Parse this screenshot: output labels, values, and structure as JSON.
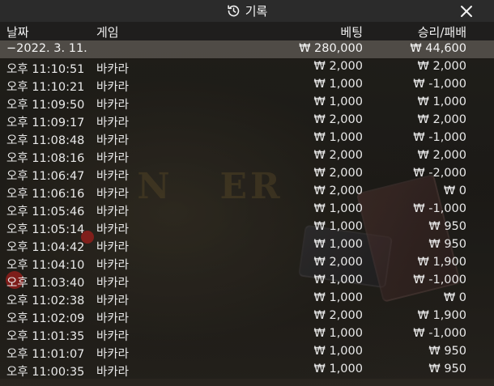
{
  "window": {
    "title": "기록",
    "icons": {
      "history": "history-icon",
      "close": "close-icon"
    }
  },
  "columns": {
    "date": "날짜",
    "game": "게임",
    "bet": "베팅",
    "win_loss": "승리/패배"
  },
  "summary": {
    "date": "−2022. 3. 11.",
    "bet": "₩ 280,000",
    "win_loss": "₩ 44,600"
  },
  "records": [
    {
      "time": "오후 11:10:51",
      "game": "바카라",
      "bet": "₩ 2,000",
      "result": "₩ 2,000"
    },
    {
      "time": "오후 11:10:21",
      "game": "바카라",
      "bet": "₩ 1,000",
      "result": "₩ -1,000"
    },
    {
      "time": "오후 11:09:50",
      "game": "바카라",
      "bet": "₩ 1,000",
      "result": "₩ 1,000"
    },
    {
      "time": "오후 11:09:17",
      "game": "바카라",
      "bet": "₩ 2,000",
      "result": "₩ 2,000"
    },
    {
      "time": "오후 11:08:48",
      "game": "바카라",
      "bet": "₩ 1,000",
      "result": "₩ -1,000"
    },
    {
      "time": "오후 11:08:16",
      "game": "바카라",
      "bet": "₩ 2,000",
      "result": "₩ 2,000"
    },
    {
      "time": "오후 11:06:47",
      "game": "바카라",
      "bet": "₩ 2,000",
      "result": "₩ -2,000"
    },
    {
      "time": "오후 11:06:16",
      "game": "바카라",
      "bet": "₩ 2,000",
      "result": "₩ 0"
    },
    {
      "time": "오후 11:05:46",
      "game": "바카라",
      "bet": "₩ 1,000",
      "result": "₩ -1,000"
    },
    {
      "time": "오후 11:05:14",
      "game": "바카라",
      "bet": "₩ 1,000",
      "result": "₩ 950"
    },
    {
      "time": "오후 11:04:42",
      "game": "바카라",
      "bet": "₩ 1,000",
      "result": "₩ 950"
    },
    {
      "time": "오후 11:04:10",
      "game": "바카라",
      "bet": "₩ 2,000",
      "result": "₩ 1,900"
    },
    {
      "time": "오후 11:03:40",
      "game": "바카라",
      "bet": "₩ 1,000",
      "result": "₩ -1,000"
    },
    {
      "time": "오후 11:02:38",
      "game": "바카라",
      "bet": "₩ 1,000",
      "result": "₩ 0"
    },
    {
      "time": "오후 11:02:09",
      "game": "바카라",
      "bet": "₩ 2,000",
      "result": "₩ 1,900"
    },
    {
      "time": "오후 11:01:35",
      "game": "바카라",
      "bet": "₩ 1,000",
      "result": "₩ -1,000"
    },
    {
      "time": "오후 11:01:07",
      "game": "바카라",
      "bet": "₩ 1,000",
      "result": "₩ 950"
    },
    {
      "time": "오후 11:00:35",
      "game": "바카라",
      "bet": "₩ 1,000",
      "result": "₩ 950"
    }
  ]
}
